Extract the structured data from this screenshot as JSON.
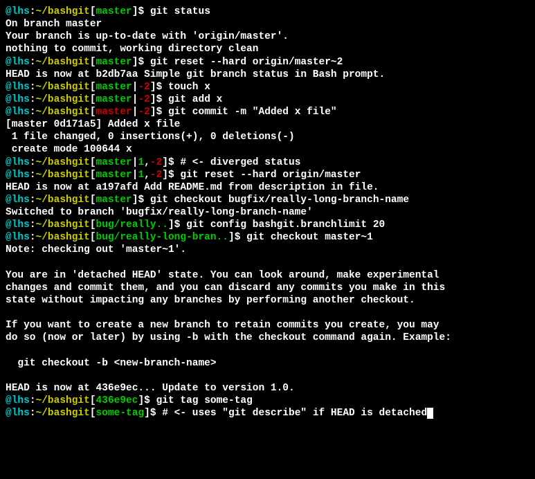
{
  "lines": [
    {
      "type": "prompt",
      "user": "@lhs",
      "host": ":",
      "path": "~/bashgit",
      "branch": "master",
      "branchColor": "green",
      "status": "",
      "statusColor": "",
      "cmd": "git status"
    },
    {
      "type": "output",
      "text": "On branch master"
    },
    {
      "type": "output",
      "text": "Your branch is up-to-date with 'origin/master'."
    },
    {
      "type": "output",
      "text": "nothing to commit, working directory clean"
    },
    {
      "type": "prompt",
      "user": "@lhs",
      "host": ":",
      "path": "~/bashgit",
      "branch": "master",
      "branchColor": "green",
      "status": "",
      "statusColor": "",
      "cmd": "git reset --hard origin/master~2"
    },
    {
      "type": "output",
      "text": "HEAD is now at b2db7aa Simple git branch status in Bash prompt."
    },
    {
      "type": "prompt",
      "user": "@lhs",
      "host": ":",
      "path": "~/bashgit",
      "branch": "master",
      "branchColor": "green",
      "status": "|-2",
      "statusColor": "red",
      "cmd": "touch x"
    },
    {
      "type": "prompt",
      "user": "@lhs",
      "host": ":",
      "path": "~/bashgit",
      "branch": "master",
      "branchColor": "green",
      "status": "|-2",
      "statusColor": "red",
      "cmd": "git add x"
    },
    {
      "type": "prompt",
      "user": "@lhs",
      "host": ":",
      "path": "~/bashgit",
      "branch": "master",
      "branchColor": "red",
      "status": "|-2",
      "statusColor": "red",
      "cmd": "git commit -m \"Added x file\""
    },
    {
      "type": "output",
      "text": "[master 0d171a5] Added x file"
    },
    {
      "type": "output",
      "text": " 1 file changed, 0 insertions(+), 0 deletions(-)"
    },
    {
      "type": "output",
      "text": " create mode 100644 x"
    },
    {
      "type": "prompt",
      "user": "@lhs",
      "host": ":",
      "path": "~/bashgit",
      "branch": "master",
      "branchColor": "green",
      "status": "|1,-2",
      "statusColor": "yellow",
      "cmd": "# <- diverged status"
    },
    {
      "type": "prompt",
      "user": "@lhs",
      "host": ":",
      "path": "~/bashgit",
      "branch": "master",
      "branchColor": "green",
      "status": "|1,-2",
      "statusColor": "yellow",
      "cmd": "git reset --hard origin/master"
    },
    {
      "type": "output",
      "text": "HEAD is now at a197afd Add README.md from description in file."
    },
    {
      "type": "prompt",
      "user": "@lhs",
      "host": ":",
      "path": "~/bashgit",
      "branch": "master",
      "branchColor": "green",
      "status": "",
      "statusColor": "",
      "cmd": "git checkout bugfix/really-long-branch-name"
    },
    {
      "type": "output",
      "text": "Switched to branch 'bugfix/really-long-branch-name'"
    },
    {
      "type": "prompt",
      "user": "@lhs",
      "host": ":",
      "path": "~/bashgit",
      "branch": "bug/really..",
      "branchColor": "green",
      "status": "",
      "statusColor": "",
      "cmd": "git config bashgit.branchlimit 20"
    },
    {
      "type": "prompt",
      "user": "@lhs",
      "host": ":",
      "path": "~/bashgit",
      "branch": "bug/really-long-bran..",
      "branchColor": "green",
      "status": "",
      "statusColor": "",
      "cmd": "git checkout master~1"
    },
    {
      "type": "output",
      "text": "Note: checking out 'master~1'."
    },
    {
      "type": "blank"
    },
    {
      "type": "output",
      "text": "You are in 'detached HEAD' state. You can look around, make experimental"
    },
    {
      "type": "output",
      "text": "changes and commit them, and you can discard any commits you make in this"
    },
    {
      "type": "output",
      "text": "state without impacting any branches by performing another checkout."
    },
    {
      "type": "blank"
    },
    {
      "type": "output",
      "text": "If you want to create a new branch to retain commits you create, you may"
    },
    {
      "type": "output",
      "text": "do so (now or later) by using -b with the checkout command again. Example:"
    },
    {
      "type": "blank"
    },
    {
      "type": "output",
      "text": "  git checkout -b <new-branch-name>"
    },
    {
      "type": "blank"
    },
    {
      "type": "output",
      "text": "HEAD is now at 436e9ec... Update to version 1.0."
    },
    {
      "type": "prompt",
      "user": "@lhs",
      "host": ":",
      "path": "~/bashgit",
      "branch": "436e9ec",
      "branchColor": "green",
      "status": "",
      "statusColor": "",
      "cmd": "git tag some-tag"
    },
    {
      "type": "prompt",
      "user": "@lhs",
      "host": ":",
      "path": "~/bashgit",
      "branch": "some-tag",
      "branchColor": "green",
      "status": "",
      "statusColor": "",
      "cmd": "# <- uses \"git describe\" if HEAD is detached",
      "cursor": true
    }
  ]
}
